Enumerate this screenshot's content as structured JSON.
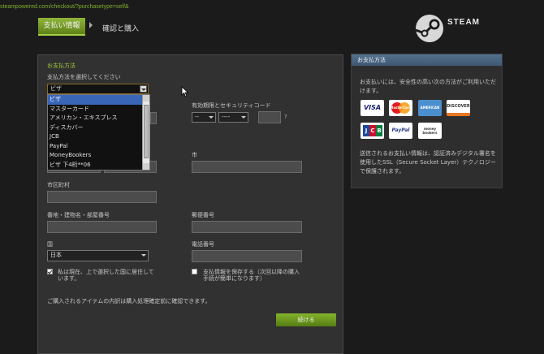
{
  "browser": {
    "url": "steampowered.com/checkout/?purchasetype=self&"
  },
  "steps": {
    "active": "支払い情報",
    "next": "確認と購入"
  },
  "brand": {
    "name": "STEAM"
  },
  "form": {
    "section_title": "お支払方法",
    "method_label": "支払方法を選択してください",
    "method_selected": "ビザ",
    "method_options": [
      "ビザ",
      "マスターカード",
      "アメリカン・エキスプレス",
      "ディスカバー",
      "JCB",
      "PayPal",
      "MoneyBookers",
      "ビザ 下4桁**06"
    ],
    "expiry_label": "有効期限とセキュリティコード",
    "expiry_month": "--",
    "expiry_year": "----",
    "help_mark": "?",
    "city_label": "市",
    "town_label": "市区町村",
    "address_label": "番地・建物名・部屋番号",
    "postal_label": "郵便番号",
    "country_label": "国",
    "country_value": "日本",
    "phone_label": "電話番号",
    "resident_checkbox": {
      "label": "私は現在、上で選択した国に居住しています。",
      "checked": true
    },
    "save_checkbox": {
      "label": "支払情報を保存する（次回以降の購入手続が簡単になります）",
      "checked": false
    },
    "note": "ご購入されるアイテムの内訳は購入処理確定前に確認できます。",
    "continue_button": "続ける"
  },
  "sidebar": {
    "title": "お支払方法",
    "intro": "お支払いには、安全性の高い次の方法がご利用いただけます。",
    "cards": [
      "VISA",
      "MasterCard",
      "AMERICAN EXPRESS",
      "DISCOVER",
      "JCB",
      "PayPal",
      "money bookers"
    ],
    "ssl_text": "送信されるお支払い情報は、認証済みデジタル署名を使用したSSL（Secure Socket Layer）テクノロジーで保護されます。"
  },
  "colors": {
    "accent_green": "#8fb53a",
    "panel": "#313131",
    "sidebar_header": "#4b6582",
    "highlight": "#3966b7"
  }
}
